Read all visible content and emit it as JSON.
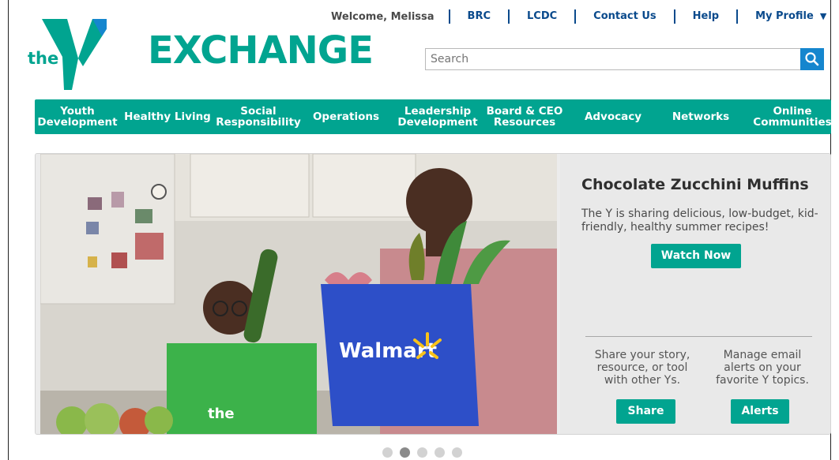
{
  "header": {
    "logo_text": "the",
    "logo_wordmark": "YMCA",
    "site_title": "EXCHANGE",
    "welcome": "Welcome, Melissa",
    "links": [
      "BRC",
      "LCDC",
      "Contact Us",
      "Help"
    ],
    "profile_label": "My Profile",
    "search": {
      "placeholder": "Search",
      "value": ""
    }
  },
  "nav": {
    "items": [
      "Youth\nDevelopment",
      "Healthy Living",
      "Social\nResponsibility",
      "Operations",
      "Leadership\nDevelopment",
      "Board & CEO\nResources",
      "Advocacy",
      "Networks",
      "Online\nCommunities"
    ]
  },
  "hero": {
    "title": "Chocolate Zucchini Muffins",
    "description": "The Y is sharing delicious, low-budget, kid-friendly, healthy summer recipes!",
    "cta_label": "Watch Now",
    "share_text": "Share your story, resource, or tool with other Ys.",
    "share_label": "Share",
    "alerts_text": "Manage email alerts on your favorite Y topics.",
    "alerts_label": "Alerts",
    "bag_text": "Walmart",
    "shirt_text": "the"
  },
  "carousel": {
    "count": 5,
    "active_index": 1
  },
  "colors": {
    "brand": "#01a490",
    "link": "#0a4a8c",
    "search_button": "#1586ce"
  }
}
